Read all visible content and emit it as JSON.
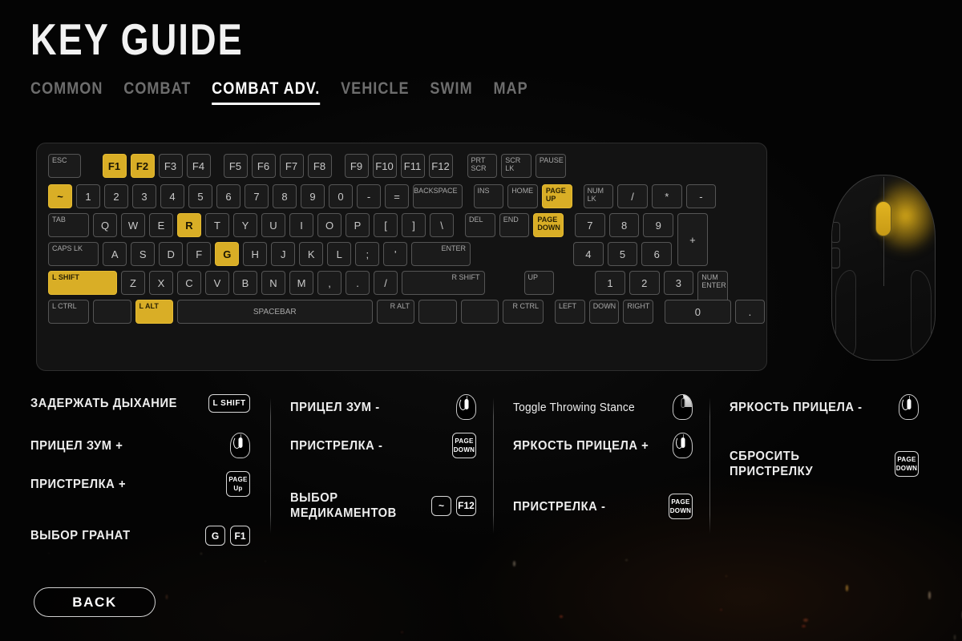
{
  "colors": {
    "highlight": "#d9ae26",
    "panel_bg": "#131313",
    "text": "#ffffff",
    "tab_inactive": "#6d6d6d"
  },
  "header": {
    "title": "KEY GUIDE",
    "tabs": [
      {
        "label": "COMMON",
        "active": false
      },
      {
        "label": "COMBAT",
        "active": false
      },
      {
        "label": "COMBAT ADV.",
        "active": true
      },
      {
        "label": "VEHICLE",
        "active": false
      },
      {
        "label": "SWIM",
        "active": false
      },
      {
        "label": "MAP",
        "active": false
      }
    ]
  },
  "keyboard": {
    "rows": {
      "function": {
        "main": [
          "ESC",
          "F1",
          "F2",
          "F3",
          "F4",
          "F5",
          "F6",
          "F7",
          "F8",
          "F9",
          "F10",
          "F11",
          "F12"
        ],
        "nav": [
          "PRT SCR",
          "SCR LK",
          "PAUSE"
        ]
      },
      "number": {
        "main": [
          "~",
          "1",
          "2",
          "3",
          "4",
          "5",
          "6",
          "7",
          "8",
          "9",
          "0",
          "-",
          "=",
          "BACKSPACE"
        ],
        "nav": [
          "INS",
          "HOME",
          "PAGE UP"
        ],
        "numpad": [
          "NUM LK",
          "/",
          "*",
          "-"
        ]
      },
      "top": {
        "main": [
          "TAB",
          "Q",
          "W",
          "E",
          "R",
          "T",
          "Y",
          "U",
          "I",
          "O",
          "P",
          "[",
          "]",
          "\\"
        ],
        "nav": [
          "DEL",
          "END",
          "PAGE DOWN"
        ],
        "numpad": [
          "7",
          "8",
          "9",
          "+"
        ]
      },
      "home": {
        "main": [
          "CAPS LK",
          "A",
          "S",
          "D",
          "F",
          "G",
          "H",
          "J",
          "K",
          "L",
          ";",
          "'",
          "ENTER"
        ],
        "numpad": [
          "4",
          "5",
          "6"
        ]
      },
      "bottom": {
        "main": [
          "L SHIFT",
          "Z",
          "X",
          "C",
          "V",
          "B",
          "N",
          "M",
          ",",
          ".",
          "/",
          "R SHIFT"
        ],
        "nav": [
          "UP"
        ],
        "numpad": [
          "1",
          "2",
          "3",
          "NUM ENTER"
        ]
      },
      "modifier": {
        "main": [
          "L CTRL",
          "",
          "L ALT",
          "SPACEBAR",
          "R ALT",
          "",
          "",
          "R CTRL"
        ],
        "nav": [
          "LEFT",
          "DOWN",
          "RIGHT"
        ],
        "numpad": [
          "0",
          "."
        ]
      }
    },
    "highlighted": [
      "F1",
      "F2",
      "~",
      "R",
      "G",
      "L SHIFT",
      "L ALT",
      "PAGE UP",
      "PAGE DOWN"
    ]
  },
  "mouse_illustration": {
    "name": "mouse-diagram",
    "highlighted_parts": [
      "right-button",
      "scroll-wheel"
    ]
  },
  "bindings": {
    "columns": [
      {
        "rows": [
          {
            "label": "ЗАДЕРЖАТЬ ДЫХАНИЕ",
            "keys": [
              {
                "type": "key-wide",
                "text": "L SHIFT"
              }
            ],
            "mixed": false
          },
          {
            "label": "ПРИЦЕЛ ЗУМ +",
            "keys": [
              {
                "type": "mouse-wheel"
              }
            ],
            "mixed": false
          },
          {
            "label": "ПРИСТРЕЛКА +",
            "keys": [
              {
                "type": "key-two",
                "line1": "PAGE",
                "line2": "Up"
              }
            ],
            "mixed": false
          },
          {
            "label": "ВЫБОР ГРАНАТ",
            "keys": [
              {
                "type": "key-sq",
                "text": "G"
              },
              {
                "type": "key-sq",
                "text": "F1"
              }
            ],
            "mixed": false
          }
        ]
      },
      {
        "rows": [
          {
            "label": "ПРИЦЕЛ ЗУМ -",
            "keys": [
              {
                "type": "mouse-wheel"
              }
            ],
            "mixed": false
          },
          {
            "label": "ПРИСТРЕЛКА -",
            "keys": [
              {
                "type": "key-two",
                "line1": "PAGE",
                "line2": "DOWN"
              }
            ],
            "mixed": false
          },
          {
            "label": "ВЫБОР\nМЕДИКАМЕНТОВ",
            "keys": [
              {
                "type": "key-sq",
                "text": "~"
              },
              {
                "type": "key-sq",
                "text": "F12"
              }
            ],
            "mixed": false
          }
        ]
      },
      {
        "rows": [
          {
            "label": "Toggle Throwing Stance",
            "keys": [
              {
                "type": "mouse-rbtn"
              }
            ],
            "mixed": true
          },
          {
            "label": "ЯРКОСТЬ ПРИЦЕЛА +",
            "keys": [
              {
                "type": "mouse-wheel"
              }
            ],
            "mixed": false
          },
          {
            "label": "ПРИСТРЕЛКА -",
            "keys": [
              {
                "type": "key-two",
                "line1": "PAGE",
                "line2": "DOWN"
              }
            ],
            "mixed": false
          }
        ]
      },
      {
        "rows": [
          {
            "label": "ЯРКОСТЬ ПРИЦЕЛА -",
            "keys": [
              {
                "type": "mouse-wheel"
              }
            ],
            "mixed": false
          },
          {
            "label": "СБРОСИТЬ\nПРИСТРЕЛКУ",
            "keys": [
              {
                "type": "key-two",
                "line1": "PAGE",
                "line2": "DOWN"
              }
            ],
            "mixed": false
          }
        ]
      }
    ]
  },
  "footer": {
    "back_label": "BACK"
  }
}
